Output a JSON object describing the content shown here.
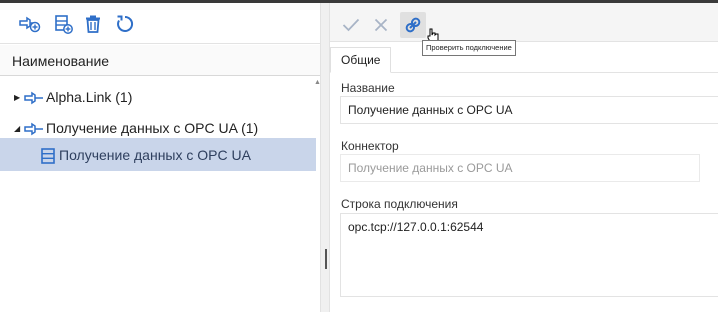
{
  "left_panel": {
    "toolbar": {
      "add_connector_icon": "add-connector-icon",
      "add_item_icon": "add-item-icon",
      "delete_icon": "trash-icon",
      "refresh_icon": "refresh-icon"
    },
    "column_header": "Наименование",
    "tree": [
      {
        "label": "Alpha.Link (1)",
        "expanded": false,
        "level": 0,
        "icon": "connector-icon"
      },
      {
        "label": "Получение данных с OPC UA (1)",
        "expanded": true,
        "level": 0,
        "icon": "connector-icon"
      },
      {
        "label": "Получение данных с OPC UA",
        "level": 1,
        "icon": "list-icon",
        "selected": true
      }
    ]
  },
  "right_panel": {
    "toolbar": {
      "apply_icon": "check-icon",
      "cancel_icon": "close-icon",
      "test_connection_icon": "link-icon",
      "tooltip": "Проверить подключение"
    },
    "tabs": [
      "Общие"
    ],
    "fields": {
      "name": {
        "label": "Название",
        "value": "Получение данных с OPC UA"
      },
      "connector": {
        "label": "Коннектор",
        "placeholder": "Получение данных с OPC UA"
      },
      "connection_string": {
        "label": "Строка подключения",
        "value": "opc.tcp://127.0.0.1:62544"
      }
    }
  },
  "colors": {
    "accent": "#2f6fc8",
    "selected_row": "#c9d5ea",
    "disabled_icon": "#a8b4c6"
  }
}
